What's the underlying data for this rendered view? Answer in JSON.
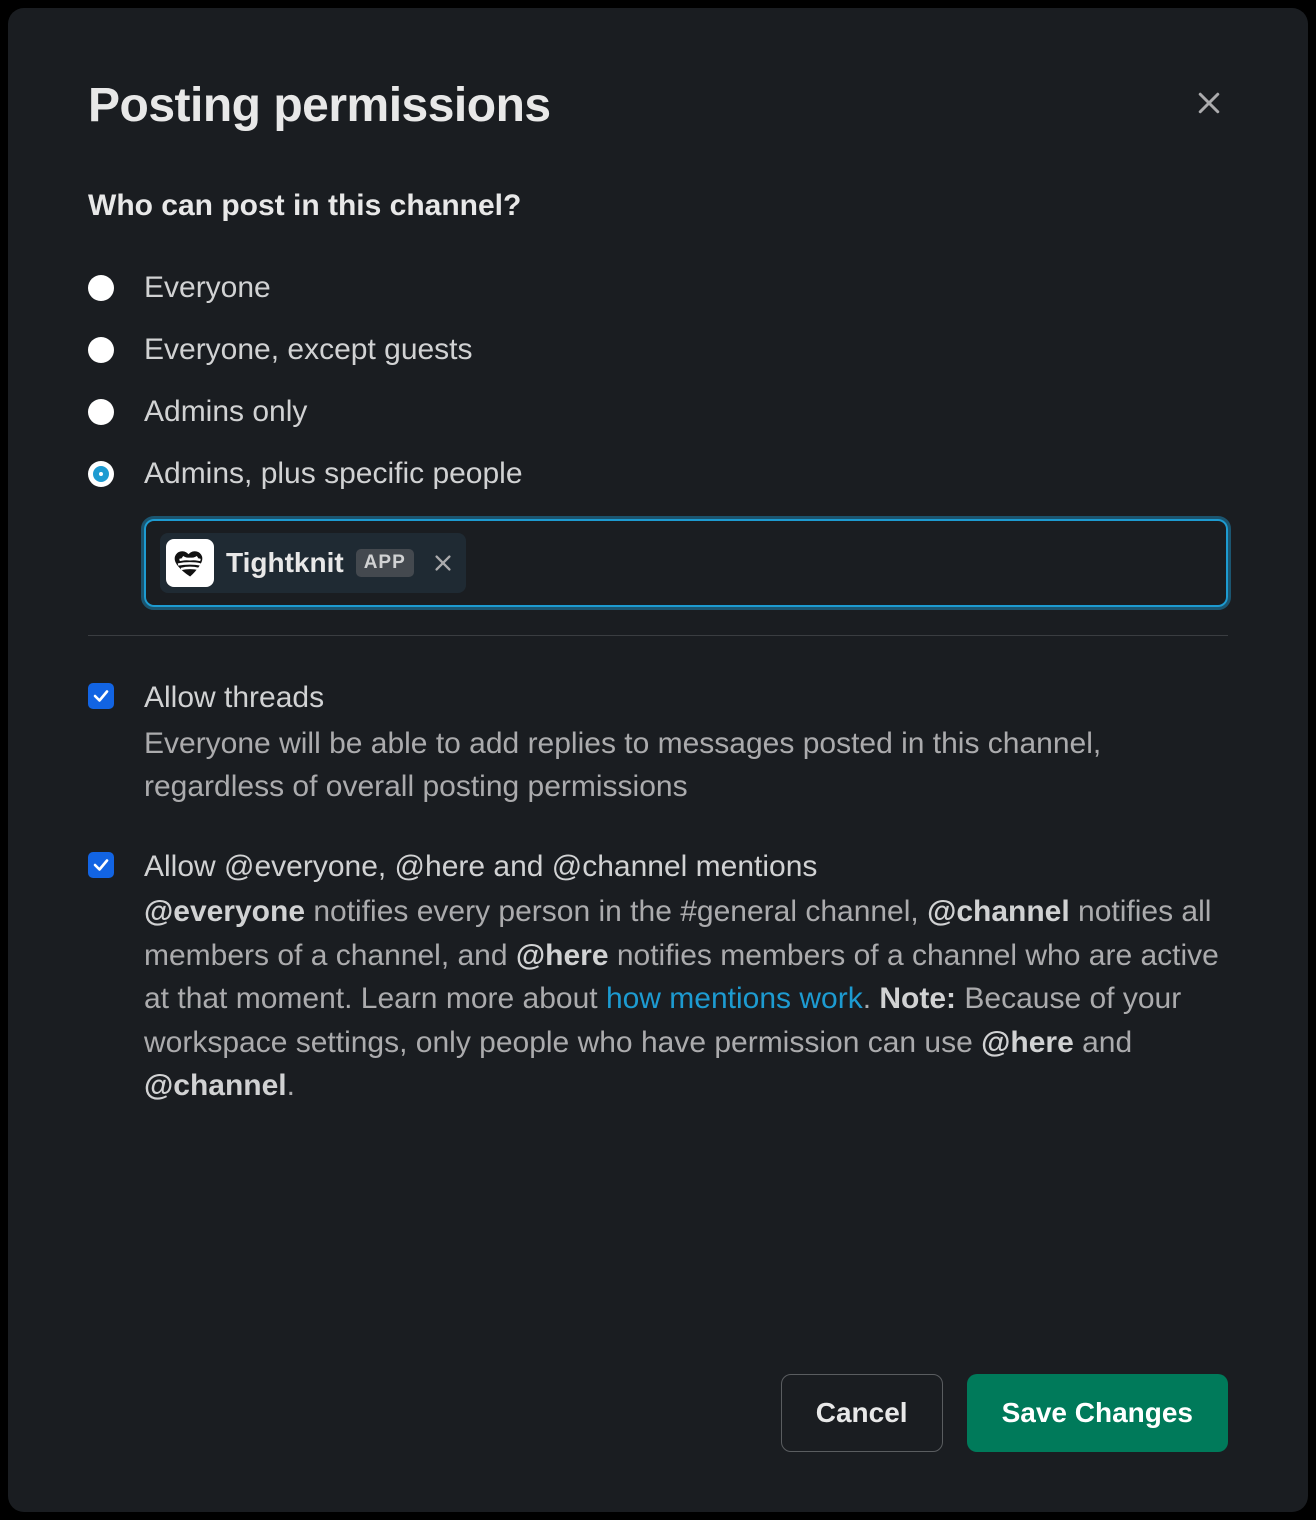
{
  "modal": {
    "title": "Posting permissions",
    "section_heading": "Who can post in this channel?"
  },
  "radios": {
    "everyone": "Everyone",
    "everyone_except_guests": "Everyone, except guests",
    "admins_only": "Admins only",
    "admins_plus": "Admins, plus specific people",
    "selected": "admins_plus"
  },
  "people_chip": {
    "name": "Tightknit",
    "badge": "APP",
    "icon": "heart-yarn-icon"
  },
  "allow_threads": {
    "checked": true,
    "title": "Allow threads",
    "desc": "Everyone will be able to add replies to messages posted in this channel, regardless of overall posting permissions"
  },
  "allow_mentions": {
    "checked": true,
    "title": "Allow @everyone, @here and @channel mentions",
    "desc_parts": {
      "t1": "@everyone",
      "t2": " notifies every person in the #general channel, ",
      "t3": "@channel",
      "t4": " notifies all members of a channel, and ",
      "t5": "@here",
      "t6": " notifies members of a channel who are active at that moment. Learn more about ",
      "link": "how mentions work",
      "t7": ". ",
      "note_label": "Note:",
      "t8": " Because of your workspace settings, only people who have permission can use ",
      "t9": "@here",
      "t10": " and ",
      "t11": "@channel",
      "t12": "."
    }
  },
  "footer": {
    "cancel": "Cancel",
    "save": "Save Changes"
  }
}
